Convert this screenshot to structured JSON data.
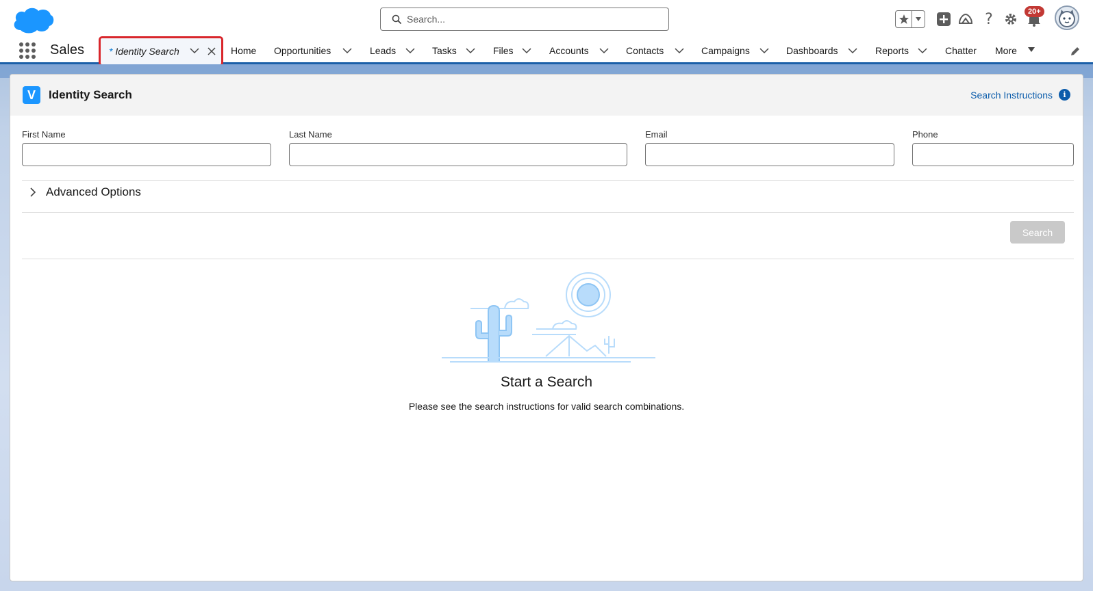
{
  "header": {
    "search_placeholder": "Search...",
    "notification_count": "20+",
    "icons": [
      "cloud-logo-icon",
      "search-icon",
      "favorites-star-icon",
      "favorites-dropdown-icon",
      "global-add-icon",
      "trailhead-icon",
      "help-icon",
      "setup-gear-icon",
      "notifications-bell-icon",
      "user-avatar"
    ]
  },
  "nav": {
    "app_name": "Sales",
    "active_tab": {
      "modified_marker": "*",
      "label": "Identity Search"
    },
    "items": [
      {
        "label": "Home",
        "has_menu": false
      },
      {
        "label": "Opportunities",
        "has_menu": true
      },
      {
        "label": "Leads",
        "has_menu": true
      },
      {
        "label": "Tasks",
        "has_menu": true
      },
      {
        "label": "Files",
        "has_menu": true
      },
      {
        "label": "Accounts",
        "has_menu": true
      },
      {
        "label": "Contacts",
        "has_menu": true
      },
      {
        "label": "Campaigns",
        "has_menu": true
      },
      {
        "label": "Dashboards",
        "has_menu": true
      },
      {
        "label": "Reports",
        "has_menu": true
      },
      {
        "label": "Chatter",
        "has_menu": false
      },
      {
        "label": "More",
        "has_menu": true
      }
    ]
  },
  "card": {
    "icon_letter": "V",
    "title": "Identity Search",
    "instructions_link": "Search Instructions",
    "info_glyph": "i",
    "fields": {
      "first_name": {
        "label": "First Name",
        "value": ""
      },
      "last_name": {
        "label": "Last Name",
        "value": ""
      },
      "email": {
        "label": "Email",
        "value": ""
      },
      "phone": {
        "label": "Phone",
        "value": ""
      }
    },
    "advanced_options_label": "Advanced Options",
    "search_button_label": "Search",
    "empty_state": {
      "title": "Start a Search",
      "subtitle": "Please see the search instructions for valid search combinations."
    }
  },
  "colors": {
    "brand_blue": "#1b96ff",
    "link_blue": "#0b5cab",
    "nav_underline": "#1b5fa8",
    "highlight_red": "#d9262b",
    "badge_red": "#c23934"
  }
}
